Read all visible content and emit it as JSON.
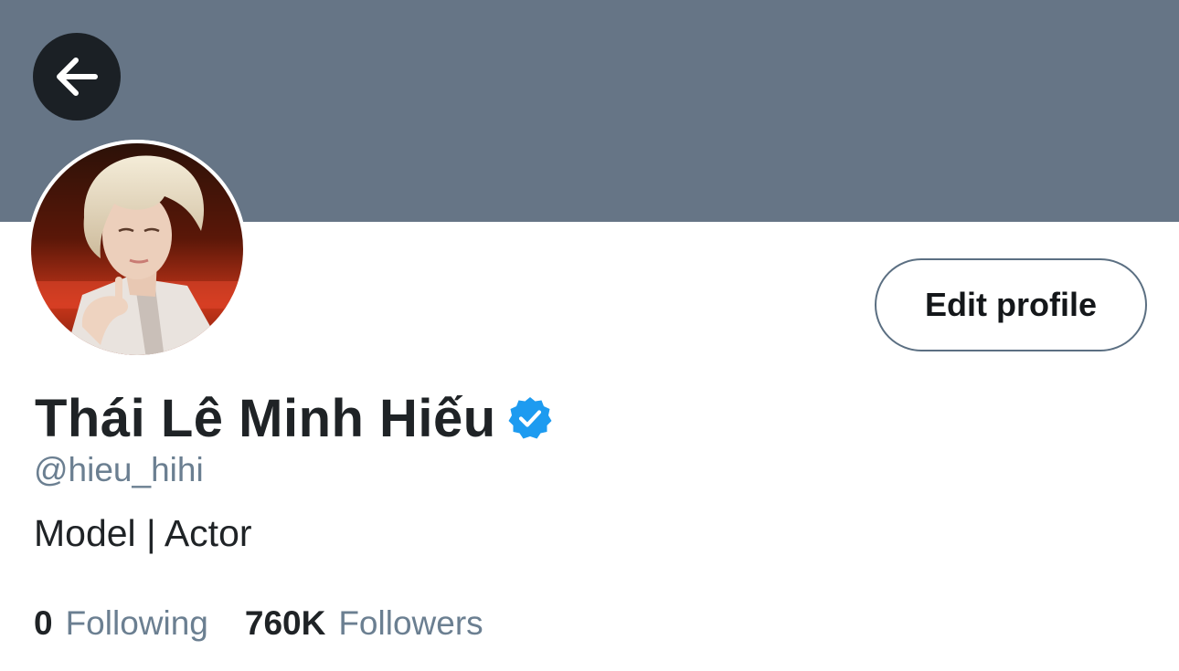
{
  "profile": {
    "name": "Thái Lê Minh Hiếu",
    "handle": "@hieu_hihi",
    "bio": "Model | Actor",
    "verified": true,
    "avatar_icon": "user-avatar-photo"
  },
  "actions": {
    "back_icon": "arrow-left-icon",
    "edit_label": "Edit profile"
  },
  "stats": {
    "following_count": "0",
    "following_label": "Following",
    "followers_count": "760K",
    "followers_label": "Followers"
  },
  "colors": {
    "banner": "#667586",
    "verified_badge": "#1d9bf0",
    "secondary_text": "#6b7f91",
    "primary_text": "#1f2326",
    "back_button_bg": "#1b2025"
  }
}
